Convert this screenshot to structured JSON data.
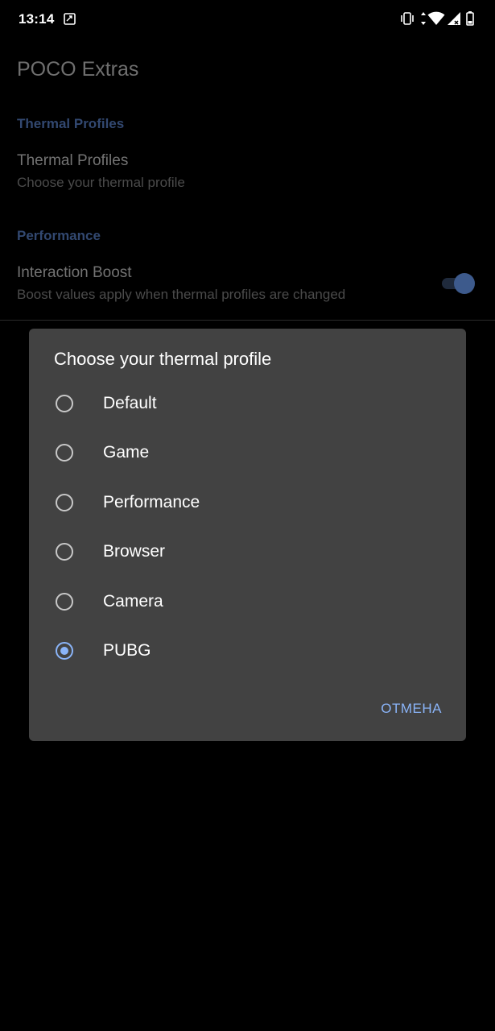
{
  "status_bar": {
    "time": "13:14",
    "left_icons": [
      "screenshot-icon"
    ],
    "right_icons": [
      "vibrate-icon",
      "data-arrows-icon",
      "wifi-icon",
      "cell-signal-icon",
      "battery-icon"
    ]
  },
  "app": {
    "title": "POCO Extras",
    "sections": [
      {
        "header": "Thermal Profiles",
        "prefs": [
          {
            "title": "Thermal Profiles",
            "summary": "Choose your thermal profile"
          }
        ]
      },
      {
        "header": "Performance",
        "prefs": [
          {
            "title": "Interaction Boost",
            "summary": "Boost values apply when thermal profiles are changed",
            "toggle_on": true
          }
        ]
      }
    ]
  },
  "dialog": {
    "title": "Choose your thermal profile",
    "options": [
      {
        "label": "Default",
        "selected": false
      },
      {
        "label": "Game",
        "selected": false
      },
      {
        "label": "Performance",
        "selected": false
      },
      {
        "label": "Browser",
        "selected": false
      },
      {
        "label": "Camera",
        "selected": false
      },
      {
        "label": "PUBG",
        "selected": true
      }
    ],
    "cancel_label": "ОТМЕНА"
  },
  "colors": {
    "accent": "#8ab4f8",
    "dialog_bg": "#424242",
    "section_header": "#324870"
  }
}
